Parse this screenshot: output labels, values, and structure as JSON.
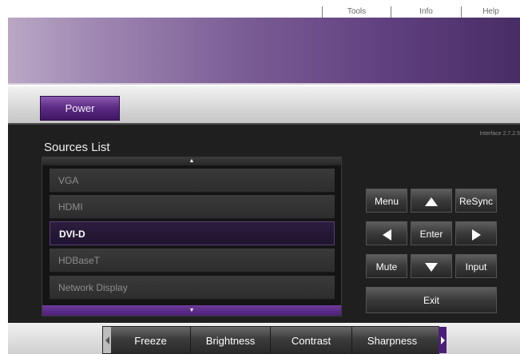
{
  "top_menu": [
    "Tools",
    "Info",
    "Help"
  ],
  "power": {
    "label": "Power"
  },
  "version": "Interface 2.7.2.5",
  "sources": {
    "title": "Sources List",
    "scroll_up_symbol": "▲",
    "scroll_down_symbol": "▼",
    "items": [
      {
        "label": "VGA",
        "active": false
      },
      {
        "label": "HDMI",
        "active": false
      },
      {
        "label": "DVI-D",
        "active": true
      },
      {
        "label": "HDBaseT",
        "active": false
      },
      {
        "label": "Network Display",
        "active": false
      }
    ]
  },
  "remote": {
    "menu": "Menu",
    "resync": "ReSync",
    "enter": "Enter",
    "mute": "Mute",
    "input": "Input",
    "exit": "Exit",
    "icons": [
      "arrow-up-icon",
      "arrow-left-icon",
      "arrow-right-icon",
      "arrow-down-icon"
    ]
  },
  "picture_controls": [
    "Freeze",
    "Brightness",
    "Contrast",
    "Sharpness"
  ],
  "colors": {
    "accent_purple": "#5d2d85",
    "header_purple": "#7c5e96",
    "panel_dark": "#1f1f1f"
  }
}
